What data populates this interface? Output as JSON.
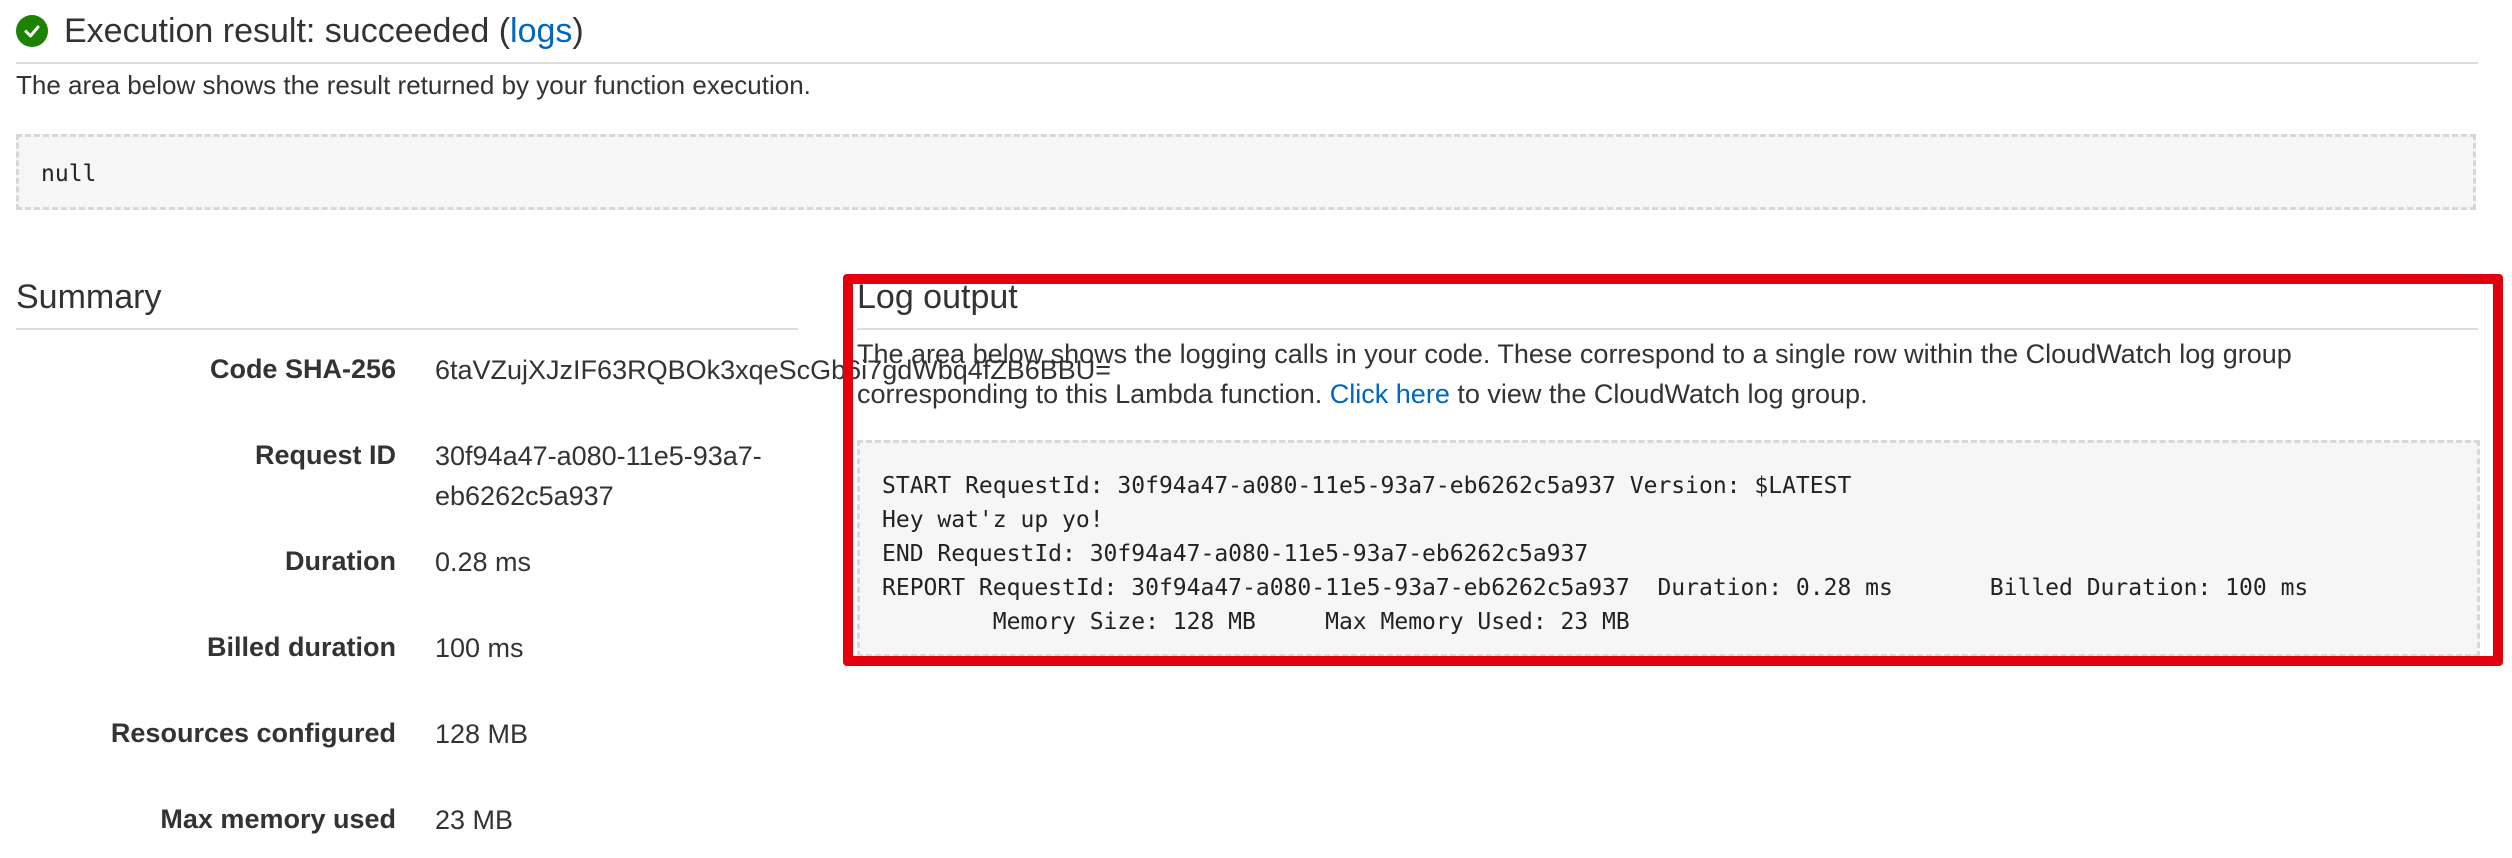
{
  "header": {
    "title_prefix": "Execution result: succeeded (",
    "logs_link": "logs",
    "title_suffix": ")",
    "description": "The area below shows the result returned by your function execution.",
    "result_value": "null"
  },
  "summary": {
    "title": "Summary",
    "rows": [
      {
        "label": "Code SHA-256",
        "value": "6taVZujXJzIF63RQBOk3xqeScGb6i7gdWbq4fZB6BBU="
      },
      {
        "label": "Request ID",
        "value": "30f94a47-a080-11e5-93a7-",
        "value2": "eb6262c5a937"
      },
      {
        "label": "Duration",
        "value": "0.28 ms"
      },
      {
        "label": "Billed duration",
        "value": "100 ms"
      },
      {
        "label": "Resources configured",
        "value": "128 MB"
      },
      {
        "label": "Max memory used",
        "value": "23 MB"
      }
    ]
  },
  "log_output": {
    "title": "Log output",
    "description_line1": "The area below shows the logging calls in your code. These correspond to a single row within the CloudWatch log group",
    "description_line2_prefix": "corresponding to this Lambda function. ",
    "click_here": "Click here",
    "description_line2_suffix": " to view the CloudWatch log group.",
    "log_text": "START RequestId: 30f94a47-a080-11e5-93a7-eb6262c5a937 Version: $LATEST\nHey wat'z up yo!\nEND RequestId: 30f94a47-a080-11e5-93a7-eb6262c5a937\nREPORT RequestId: 30f94a47-a080-11e5-93a7-eb6262c5a937  Duration: 0.28 ms       Billed Duration: 100 ms\n        Memory Size: 128 MB     Max Memory Used: 23 MB"
  },
  "colors": {
    "success": "#1d8102",
    "link": "#0066bf",
    "highlight": "#e2000c"
  },
  "icons": {
    "status": "check-circle-icon"
  }
}
